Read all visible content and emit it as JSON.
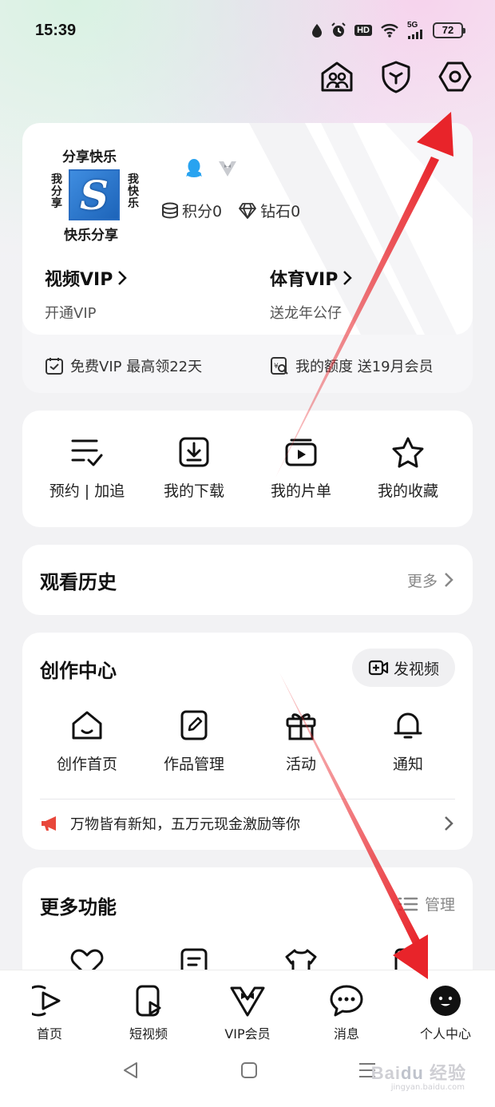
{
  "status_bar": {
    "time": "15:39",
    "network": "5G",
    "battery": "72"
  },
  "profile": {
    "avatar_text": {
      "top": "分享快乐",
      "bottom": "快乐分享",
      "left": "我分享",
      "right": "我快乐"
    },
    "points_label": "积分0",
    "diamonds_label": "钻石0",
    "video_vip": {
      "title": "视频VIP",
      "subtitle": "开通VIP"
    },
    "sports_vip": {
      "title": "体育VIP",
      "subtitle": "送龙年公仔"
    },
    "promos": [
      {
        "icon": "calendar-check-icon",
        "text": "免费VIP 最高领22天"
      },
      {
        "icon": "coupon-search-icon",
        "text": "我的额度 送19月会员"
      }
    ]
  },
  "quick_actions": [
    {
      "icon": "list-check-icon",
      "label": "预约 | 加追"
    },
    {
      "icon": "download-icon",
      "label": "我的下载"
    },
    {
      "icon": "playlist-icon",
      "label": "我的片单"
    },
    {
      "icon": "star-icon",
      "label": "我的收藏"
    }
  ],
  "history": {
    "title": "观看历史",
    "more": "更多"
  },
  "create_center": {
    "title": "创作中心",
    "publish_label": "发视频",
    "items": [
      {
        "icon": "home-icon",
        "label": "创作首页"
      },
      {
        "icon": "edit-doc-icon",
        "label": "作品管理"
      },
      {
        "icon": "gift-icon",
        "label": "活动"
      },
      {
        "icon": "bell-icon",
        "label": "通知"
      }
    ],
    "notice": "万物皆有新知，五万元现金激励等你"
  },
  "more_features": {
    "title": "更多功能",
    "manage": "管理"
  },
  "tabs": [
    {
      "icon": "play-circle-icon",
      "label": "首页"
    },
    {
      "icon": "short-video-icon",
      "label": "短视频"
    },
    {
      "icon": "vip-bowtie-icon",
      "label": "VIP会员"
    },
    {
      "icon": "message-icon",
      "label": "消息"
    },
    {
      "icon": "profile-face-icon",
      "label": "个人中心",
      "active": true
    }
  ],
  "colors": {
    "arrow": "#e8242a",
    "accent": "#111111"
  }
}
